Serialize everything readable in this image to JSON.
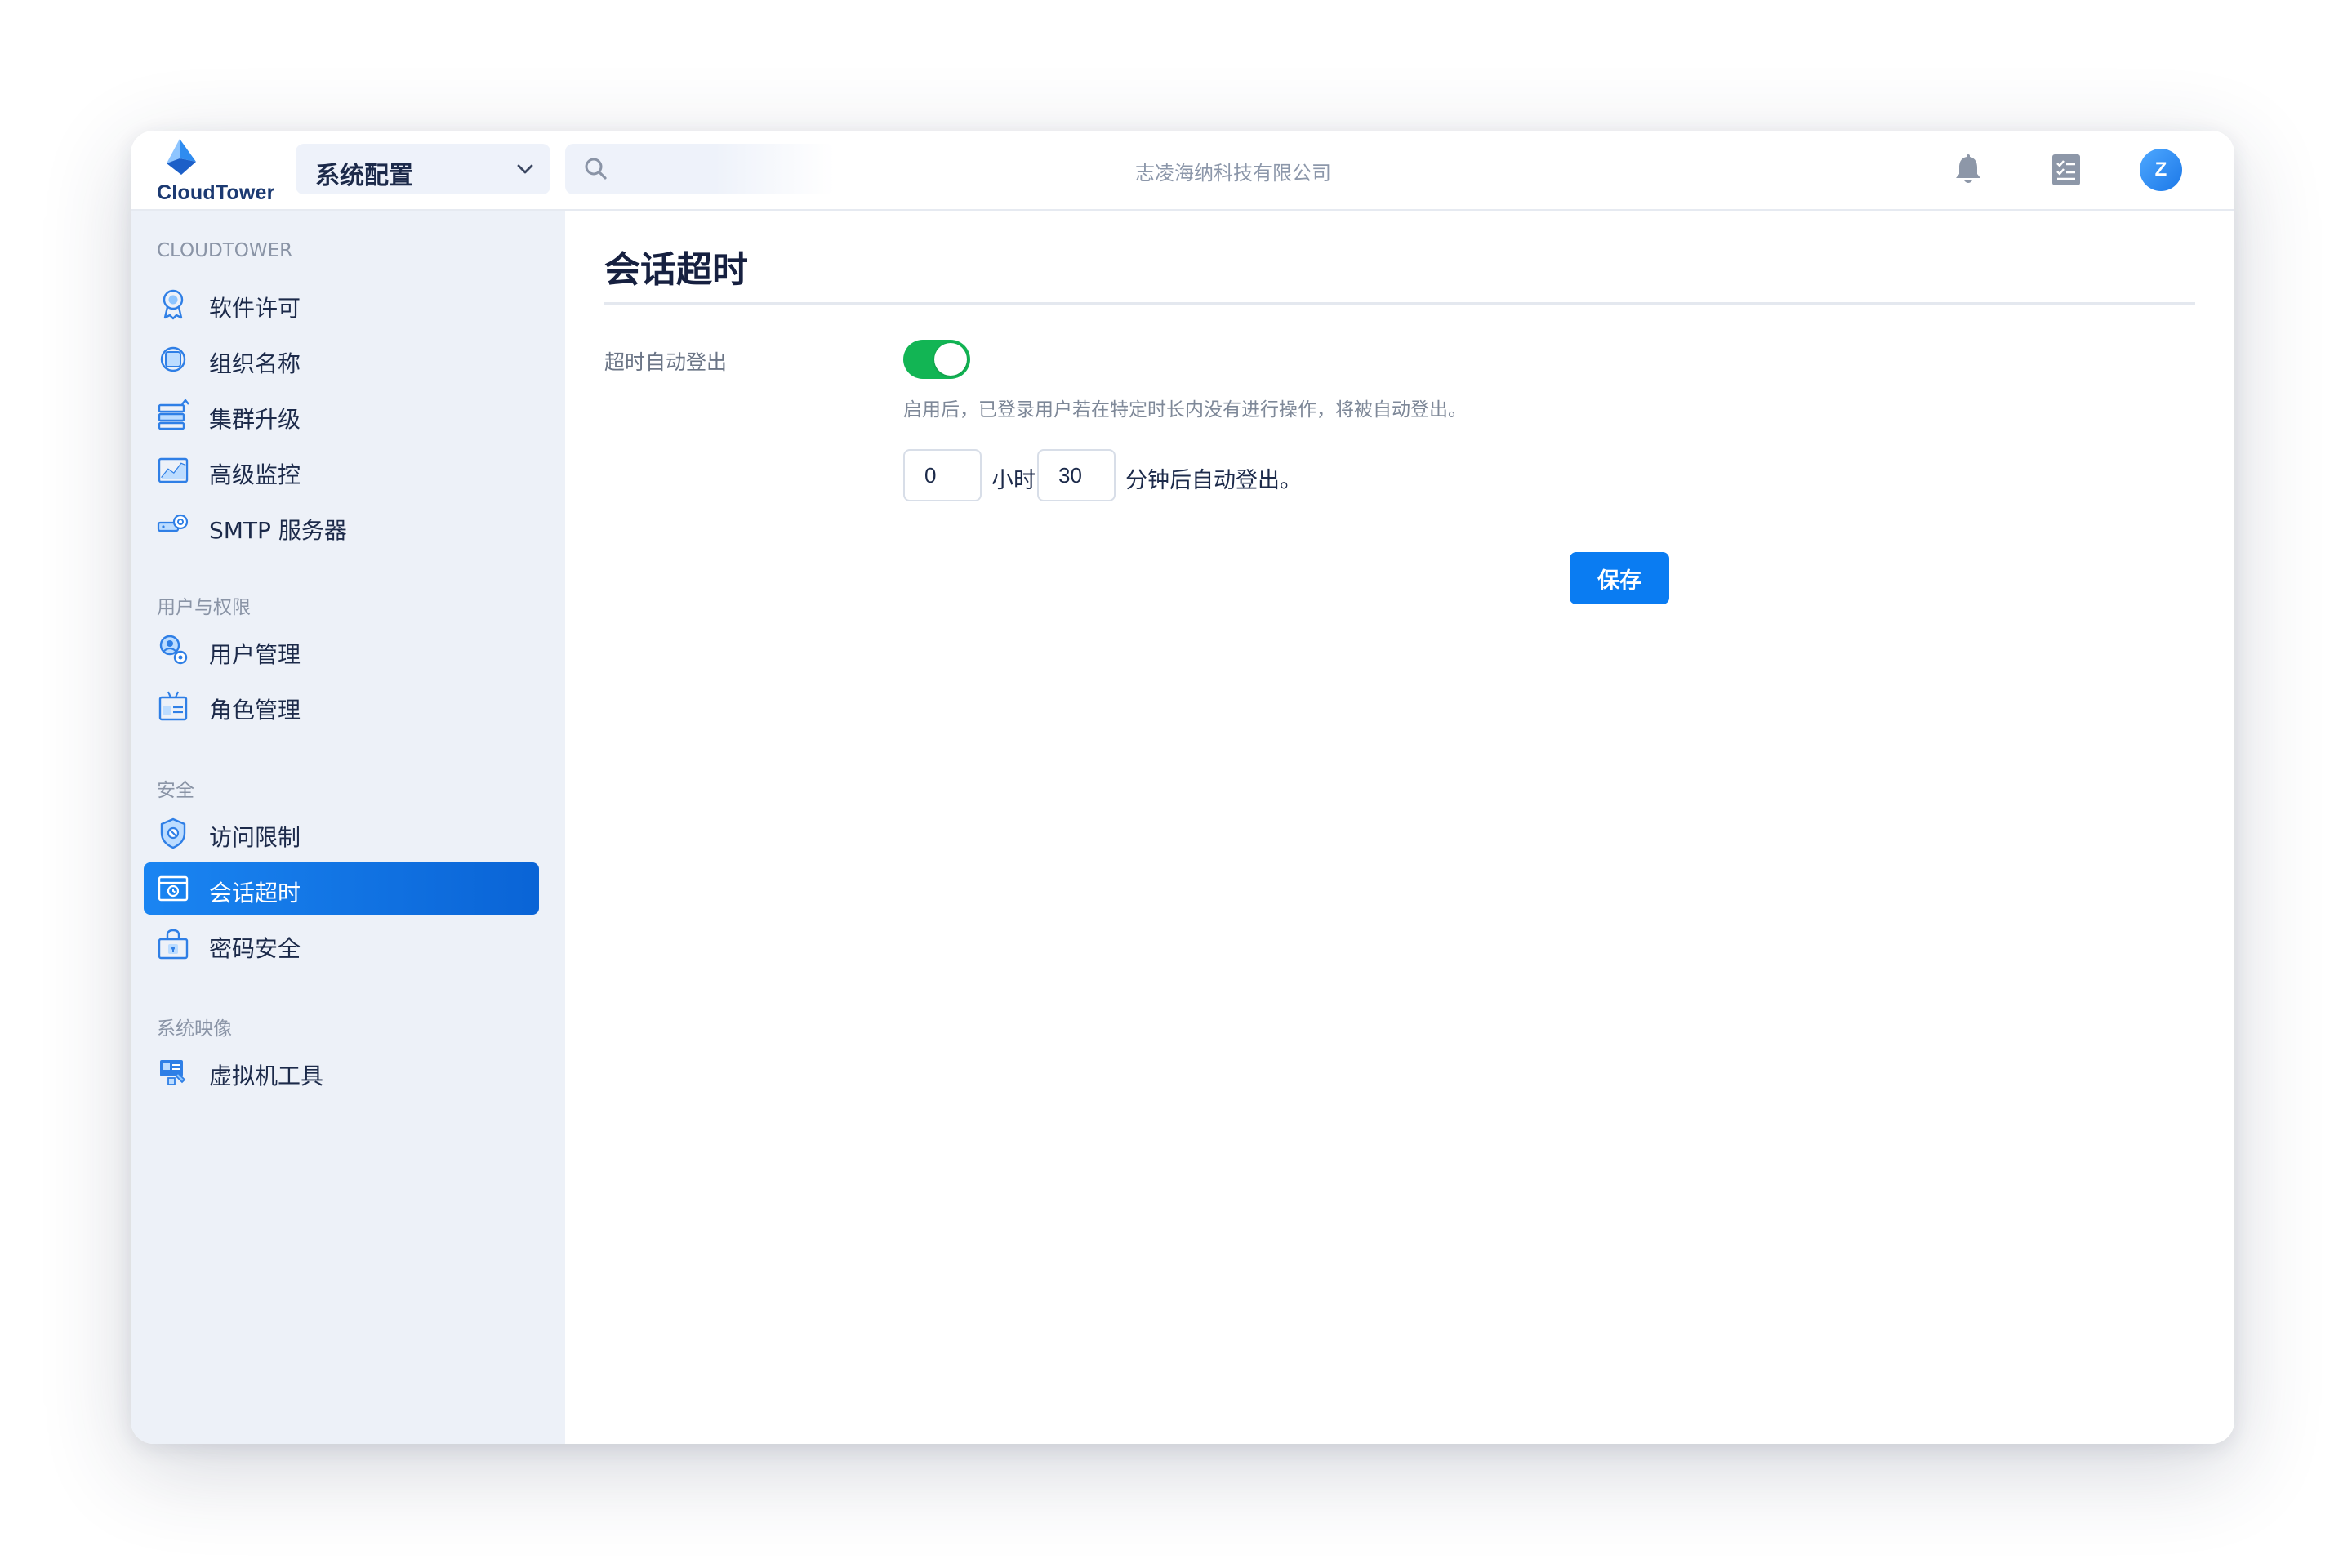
{
  "app": {
    "logo_text": "CloudTower"
  },
  "header": {
    "context_select": "系统配置",
    "org_name": "志凌海纳科技有限公司",
    "avatar_initial": "Z"
  },
  "sidebar": {
    "sections": [
      {
        "title": "CLOUDTOWER",
        "items": [
          {
            "label": "软件许可",
            "icon": "license-icon"
          },
          {
            "label": "组织名称",
            "icon": "organization-icon"
          },
          {
            "label": "集群升级",
            "icon": "cluster-upgrade-icon"
          },
          {
            "label": "高级监控",
            "icon": "advanced-monitor-icon"
          },
          {
            "label": "SMTP 服务器",
            "icon": "smtp-icon"
          }
        ]
      },
      {
        "title": "用户与权限",
        "items": [
          {
            "label": "用户管理",
            "icon": "user-manage-icon"
          },
          {
            "label": "角色管理",
            "icon": "role-manage-icon"
          }
        ]
      },
      {
        "title": "安全",
        "items": [
          {
            "label": "访问限制",
            "icon": "access-limit-icon"
          },
          {
            "label": "会话超时",
            "icon": "session-timeout-icon",
            "active": true
          },
          {
            "label": "密码安全",
            "icon": "password-security-icon"
          }
        ]
      },
      {
        "title": "系统映像",
        "items": [
          {
            "label": "虚拟机工具",
            "icon": "vm-tools-icon"
          }
        ]
      }
    ]
  },
  "main": {
    "title": "会话超时",
    "field_label": "超时自动登出",
    "toggle_on": true,
    "hint": "启用后，已登录用户若在特定时长内没有进行操作，将被自动登出。",
    "hours_value": "0",
    "hours_unit": "小时",
    "minutes_value": "30",
    "minutes_unit": "分钟后自动登出。",
    "save_label": "保存"
  },
  "colors": {
    "accent": "#0a7cf2",
    "toggle_on": "#12b554",
    "sidebar_bg": "#edf1f8",
    "text_primary": "#1c2a4a"
  }
}
